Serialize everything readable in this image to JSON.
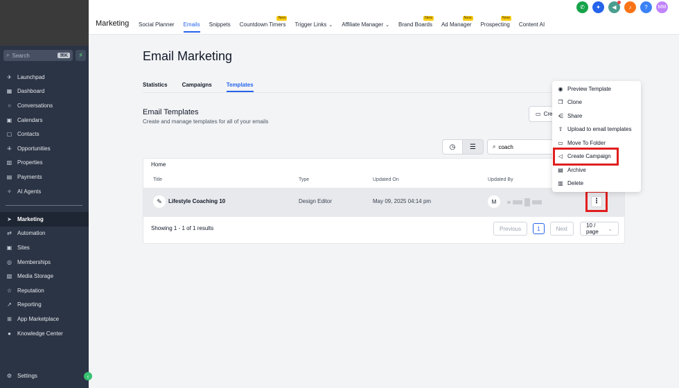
{
  "sidebar": {
    "search_placeholder": "Search",
    "search_shortcut": "⌘K",
    "items": [
      {
        "label": "Launchpad",
        "icon": "rocket-icon"
      },
      {
        "label": "Dashboard",
        "icon": "grid-icon"
      },
      {
        "label": "Conversations",
        "icon": "chat-icon"
      },
      {
        "label": "Calendars",
        "icon": "calendar-icon"
      },
      {
        "label": "Contacts",
        "icon": "contact-icon"
      },
      {
        "label": "Opportunities",
        "icon": "network-icon"
      },
      {
        "label": "Properties",
        "icon": "building-icon"
      },
      {
        "label": "Payments",
        "icon": "wallet-icon"
      },
      {
        "label": "AI Agents",
        "icon": "sparkle-icon"
      }
    ],
    "items2": [
      {
        "label": "Marketing",
        "icon": "send-icon",
        "active": true
      },
      {
        "label": "Automation",
        "icon": "automation-icon"
      },
      {
        "label": "Sites",
        "icon": "sites-icon"
      },
      {
        "label": "Memberships",
        "icon": "membership-icon"
      },
      {
        "label": "Media Storage",
        "icon": "media-icon"
      },
      {
        "label": "Reputation",
        "icon": "star-icon"
      },
      {
        "label": "Reporting",
        "icon": "trend-icon"
      },
      {
        "label": "App Marketplace",
        "icon": "apps-icon"
      },
      {
        "label": "Knowledge Center",
        "icon": "info-icon"
      }
    ],
    "settings_label": "Settings"
  },
  "topbar": {
    "title": "Marketing",
    "nav": [
      {
        "label": "Social Planner"
      },
      {
        "label": "Emails",
        "active": true
      },
      {
        "label": "Snippets"
      },
      {
        "label": "Countdown Timers",
        "badge": "New"
      },
      {
        "label": "Trigger Links",
        "dropdown": true
      },
      {
        "label": "Affiliate Manager",
        "dropdown": true
      },
      {
        "label": "Brand Boards",
        "badge": "New"
      },
      {
        "label": "Ad Manager",
        "badge": "New"
      },
      {
        "label": "Prospecting",
        "badge": "New"
      },
      {
        "label": "Content AI"
      }
    ],
    "icons": [
      {
        "name": "phone-icon",
        "color": "#16a34a",
        "glyph": "✆"
      },
      {
        "name": "megaphone-icon",
        "color": "#2563eb",
        "glyph": "✦"
      },
      {
        "name": "announcement-icon",
        "color": "#4b9e8f",
        "glyph": "◀"
      },
      {
        "name": "bell-icon",
        "color": "#f97316",
        "glyph": "♪"
      },
      {
        "name": "help-icon",
        "color": "#3b82f6",
        "glyph": "?"
      },
      {
        "name": "user-avatar",
        "color": "#c084fc",
        "glyph": "MM"
      }
    ]
  },
  "main": {
    "title": "Email Marketing",
    "tabs": [
      {
        "label": "Statistics"
      },
      {
        "label": "Campaigns"
      },
      {
        "label": "Templates",
        "active": true
      }
    ],
    "section_title": "Email Templates",
    "section_subtitle": "Create and manage templates for all of your emails",
    "create_label": "Cre",
    "search_value": "coach",
    "breadcrumb": "Home",
    "columns": [
      "Title",
      "Type",
      "Updated On",
      "Updated By"
    ],
    "rows": [
      {
        "title": "Lifestyle Coaching 10",
        "type": "Design Editor",
        "updated_on": "May 09, 2025 04:14 pm",
        "avatar": "M"
      }
    ],
    "results": "Showing 1 - 1 of 1 results",
    "pager": {
      "previous": "Previous",
      "page": "1",
      "next": "Next",
      "page_size": "10 / page"
    }
  },
  "menu": {
    "items": [
      {
        "label": "Preview Template",
        "icon": "eye-icon",
        "glyph": "◉"
      },
      {
        "label": "Clone",
        "icon": "copy-icon",
        "glyph": "❐"
      },
      {
        "label": "Share",
        "icon": "share-icon",
        "glyph": "⋲"
      },
      {
        "label": "Upload to email templates",
        "icon": "upload-icon",
        "glyph": "⇧"
      },
      {
        "label": "Move To Folder",
        "icon": "folder-icon",
        "glyph": "▭"
      },
      {
        "label": "Create Campaign",
        "icon": "megaphone-icon",
        "glyph": "◁"
      },
      {
        "label": "Archive",
        "icon": "archive-icon",
        "glyph": "▤"
      },
      {
        "label": "Delete",
        "icon": "trash-icon",
        "glyph": "▥"
      }
    ]
  }
}
